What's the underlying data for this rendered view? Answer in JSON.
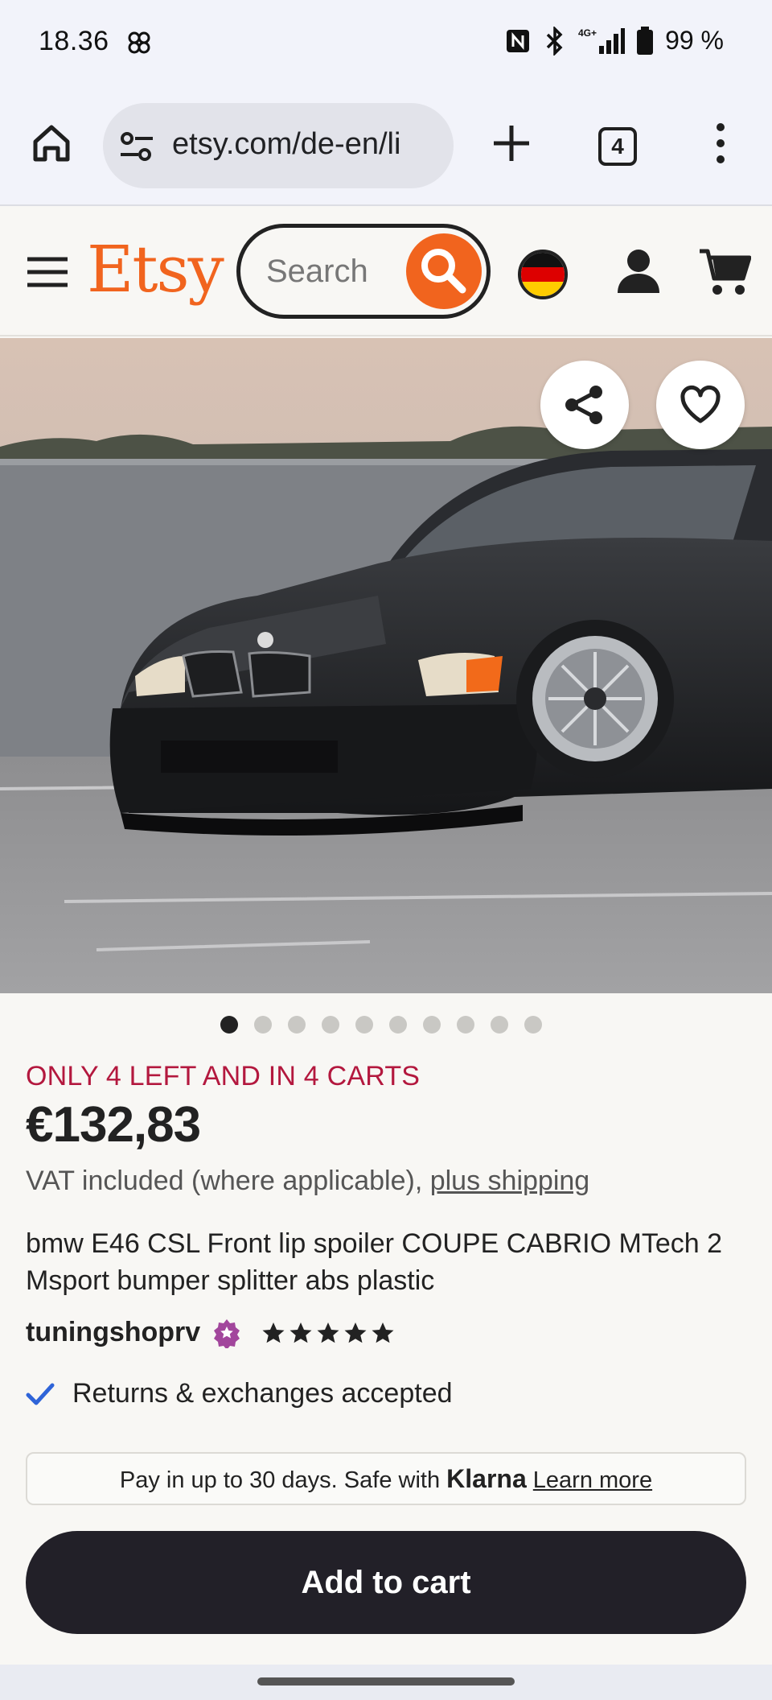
{
  "status_bar": {
    "time": "18.36",
    "battery": "99 %",
    "network": "4G+"
  },
  "browser": {
    "url": "etsy.com/de-en/li",
    "tab_count": "4"
  },
  "header": {
    "logo": "Etsy",
    "search_placeholder": "Search",
    "brand_color": "#f1641e"
  },
  "gallery": {
    "image_count": 10,
    "active_index": 0
  },
  "listing": {
    "stock_notice": "ONLY 4 LEFT AND IN 4 CARTS",
    "price": "€132,83",
    "vat_text": "VAT included (where applicable), ",
    "shipping_link": "plus shipping",
    "title": "bmw E46 CSL Front lip spoiler COUPE CABRIO MTech 2 Msport bumper splitter abs plastic",
    "shop_name": "tuningshoprv",
    "rating_stars": 5,
    "returns": "Returns & exchanges accepted"
  },
  "klarna": {
    "text": "Pay in up to 30 days. Safe with ",
    "brand": "Klarna",
    "link": "Learn more"
  },
  "actions": {
    "add_to_cart": "Add to cart"
  }
}
